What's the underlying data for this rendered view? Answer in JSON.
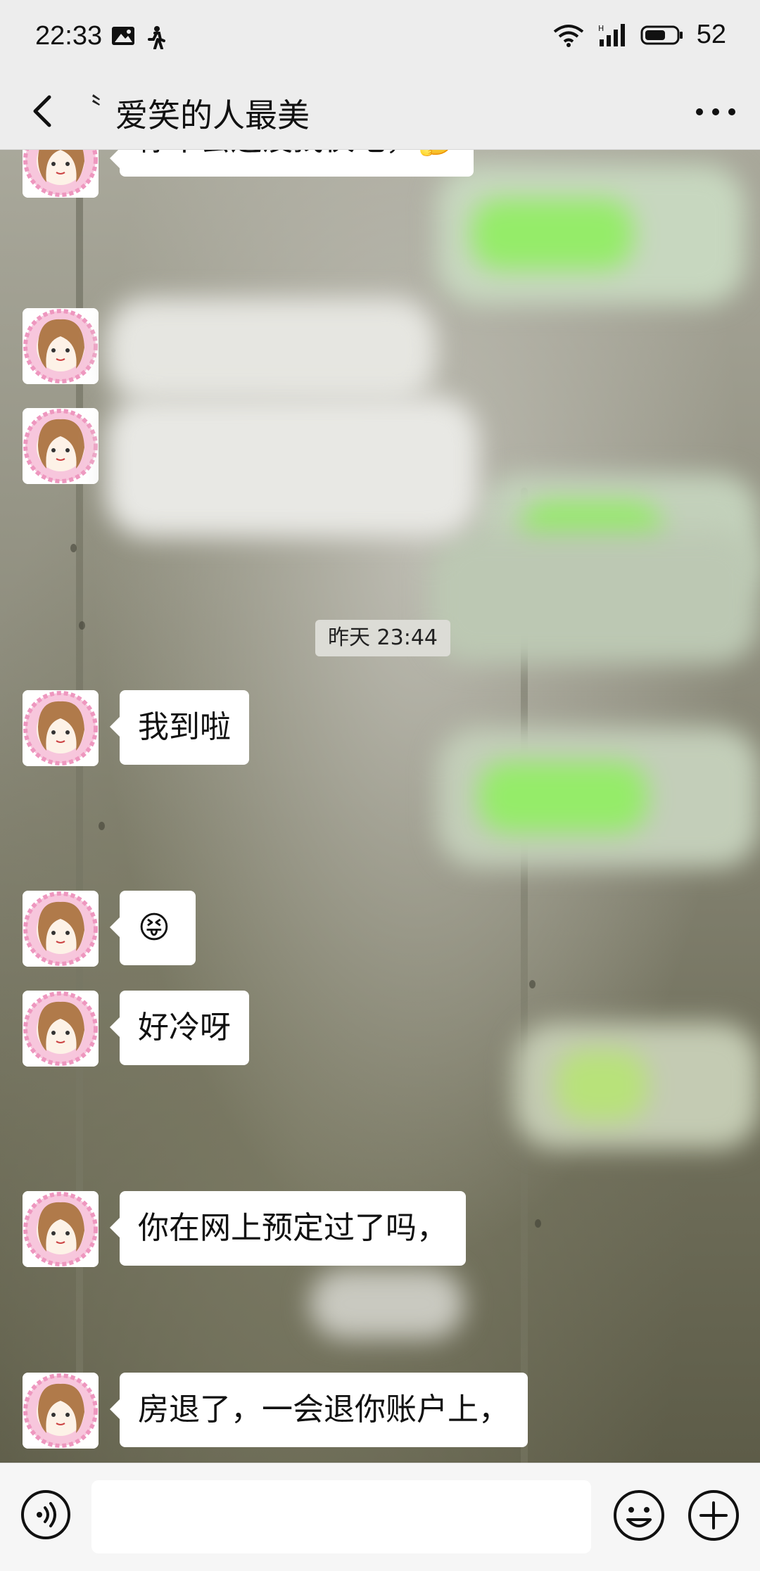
{
  "status_bar": {
    "time": "22:33",
    "battery": "52",
    "icons": [
      "photo-icon",
      "walking-icon",
      "wifi-icon",
      "signal-icon",
      "battery-icon"
    ]
  },
  "header": {
    "title_mark": "〝",
    "title": "爱笑的人最美",
    "back_icon": "chevron-left-icon",
    "more_icon": "more-dots-icon"
  },
  "chat": {
    "messages": [
      {
        "id": "m1",
        "text": "你不会还没找伙吧，",
        "emoji": "🤔"
      },
      {
        "id": "m2",
        "text": "我到啦"
      },
      {
        "id": "m3",
        "emoji": "😝"
      },
      {
        "id": "m4",
        "text": "好冷呀"
      },
      {
        "id": "m5",
        "text": "你在网上预定过了吗，"
      },
      {
        "id": "m6",
        "text": "房退了，一会退你账户上，"
      }
    ],
    "timestamp": "昨天 23:44"
  },
  "input_bar": {
    "voice_icon": "voice-icon",
    "emoji_icon": "emoji-icon",
    "plus_icon": "plus-icon"
  },
  "colors": {
    "bar_bg": "#ededed",
    "bubble_bg": "#ffffff",
    "own_bubble_blurred": "#95ec69",
    "avatar_frame": "#f2a9c9"
  }
}
